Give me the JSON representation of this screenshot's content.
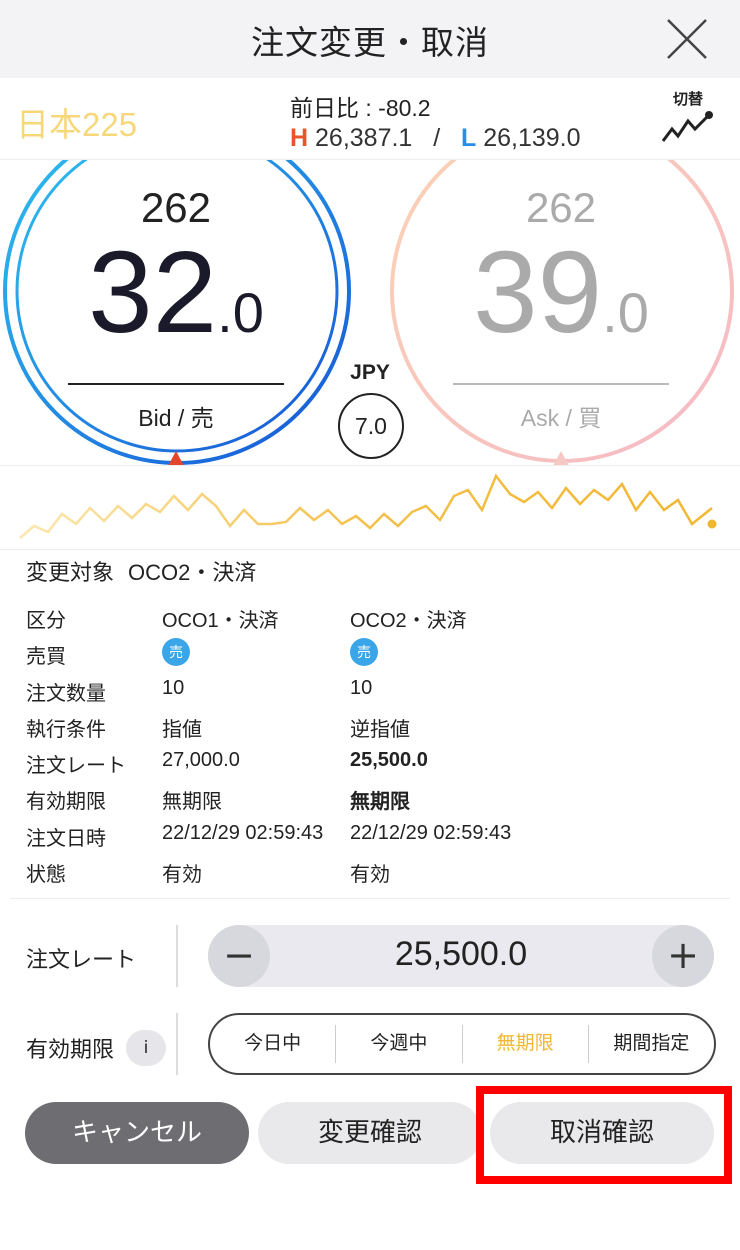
{
  "header": {
    "title": "注文変更・取消"
  },
  "ticker": {
    "symbol": "日本225",
    "prev_diff": "前日比 : -80.2",
    "high_marker": "H",
    "high": "26,387.1",
    "hl_sep": "/",
    "low_marker": "L",
    "low": "26,139.0",
    "switch_label": "切替"
  },
  "bid": {
    "head": "262",
    "main": "32",
    "frac": ".0",
    "label": "Bid / 売"
  },
  "ask": {
    "head": "262",
    "main": "39",
    "frac": ".0",
    "label": "Ask / 買"
  },
  "currency": "JPY",
  "spread": "7.0",
  "colors": {
    "bid_blue": "#1a7fe0",
    "ask_pink": "#f5b9b2",
    "chart_line": "#f1b731",
    "accent_yellow": "#f1b731",
    "highlight_red": "#ff0000"
  },
  "order": {
    "target_label": "変更対象",
    "target_value": "OCO2・決済",
    "rows": [
      {
        "label": "区分",
        "c1": "OCO1・決済",
        "c2": "OCO2・決済"
      },
      {
        "label": "売買",
        "c1": "売",
        "c2": "売"
      },
      {
        "label": "注文数量",
        "c1": "10",
        "c2": "10"
      },
      {
        "label": "執行条件",
        "c1": "指値",
        "c2": "逆指値"
      },
      {
        "label": "注文レート",
        "c1": "27,000.0",
        "c2": "25,500.0"
      },
      {
        "label": "有効期限",
        "c1": "無期限",
        "c2": "無期限"
      },
      {
        "label": "注文日時",
        "c1": "22/12/29 02:59:43",
        "c2": "22/12/29 02:59:43"
      },
      {
        "label": "状態",
        "c1": "有効",
        "c2": "有効"
      }
    ]
  },
  "rate_input": {
    "label": "注文レート",
    "value": "25,500.0",
    "minus": "−",
    "plus": "+"
  },
  "expiry": {
    "label": "有効期限",
    "info": "i",
    "options": [
      "今日中",
      "今週中",
      "無期限",
      "期間指定"
    ],
    "selected": "無期限"
  },
  "buttons": {
    "cancel": "キャンセル",
    "confirm_change": "変更確認",
    "confirm_cancel": "取消確認"
  }
}
